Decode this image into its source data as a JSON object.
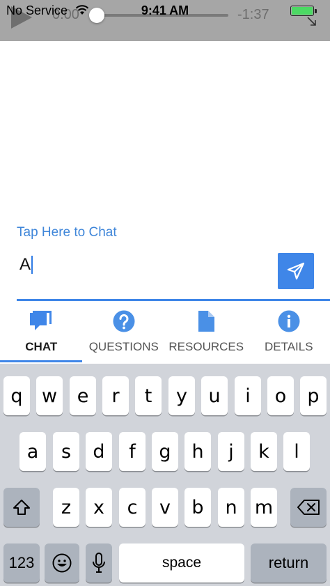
{
  "status_bar": {
    "carrier": "No Service",
    "time": "9:41 AM"
  },
  "video": {
    "elapsed": "0:00",
    "remaining": "-1:37"
  },
  "chat": {
    "prompt": "Tap Here to Chat",
    "input_value": "A"
  },
  "tabs": [
    {
      "label": "CHAT",
      "icon": "chat-bubble-icon"
    },
    {
      "label": "QUESTIONS",
      "icon": "question-circle-icon"
    },
    {
      "label": "RESOURCES",
      "icon": "document-icon"
    },
    {
      "label": "DETAILS",
      "icon": "info-circle-icon"
    }
  ],
  "keyboard": {
    "row1": [
      "q",
      "w",
      "e",
      "r",
      "t",
      "y",
      "u",
      "i",
      "o",
      "p"
    ],
    "row2": [
      "a",
      "s",
      "d",
      "f",
      "g",
      "h",
      "j",
      "k",
      "l"
    ],
    "row3": [
      "z",
      "x",
      "c",
      "v",
      "b",
      "n",
      "m"
    ],
    "numbers": "123",
    "space": "space",
    "return": "return"
  },
  "colors": {
    "accent": "#3f86e8",
    "battery": "#4cd964"
  }
}
